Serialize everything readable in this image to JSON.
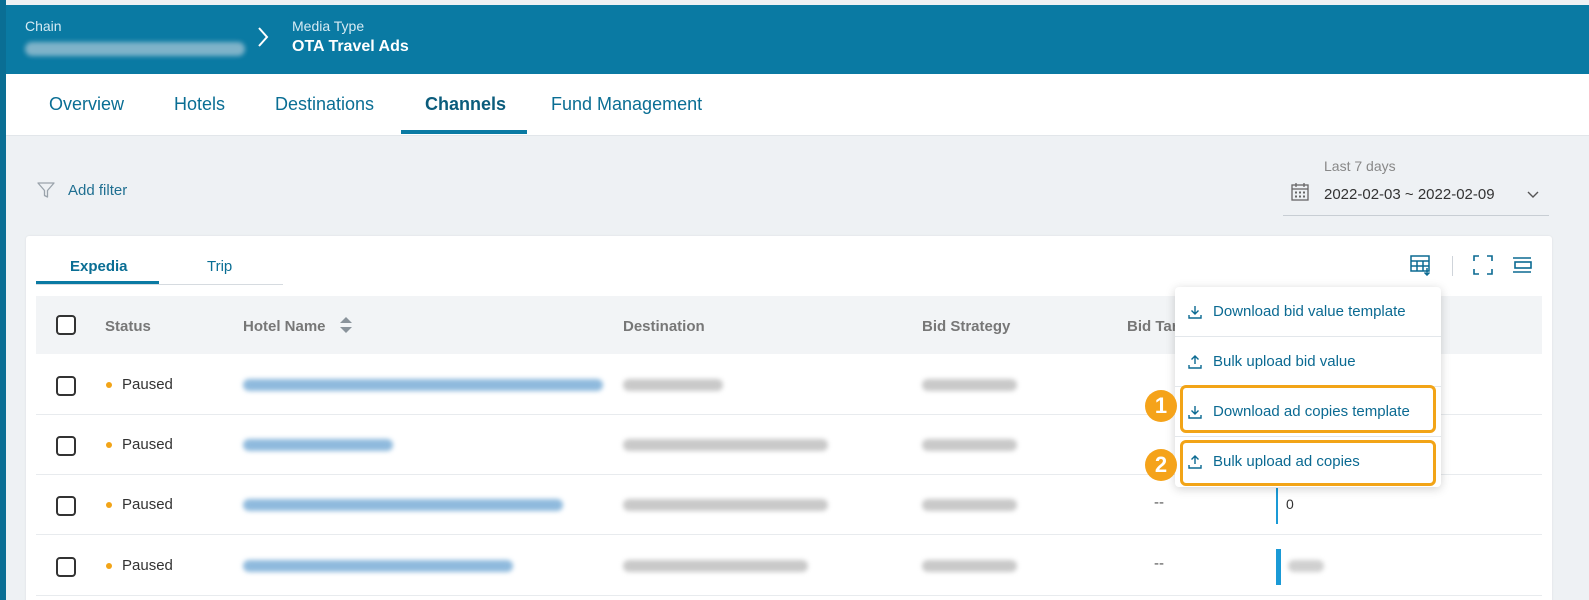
{
  "breadcrumb": {
    "chain_label": "Chain",
    "media_type_label": "Media Type",
    "media_type_value": "OTA Travel Ads"
  },
  "tabs": [
    {
      "label": "Overview"
    },
    {
      "label": "Hotels"
    },
    {
      "label": "Destinations"
    },
    {
      "label": "Channels",
      "active": true
    },
    {
      "label": "Fund Management"
    }
  ],
  "filter": {
    "label": "Add filter"
  },
  "date_range": {
    "preset": "Last 7 days",
    "value": "2022-02-03 ~ 2022-02-09"
  },
  "channel_tabs": [
    {
      "label": "Expedia",
      "active": true
    },
    {
      "label": "Trip"
    }
  ],
  "table": {
    "columns": [
      "Status",
      "Hotel Name",
      "Destination",
      "Bid Strategy",
      "Bid Tar"
    ],
    "rows": [
      {
        "status": "Paused",
        "bid_target": "",
        "bid_value": ""
      },
      {
        "status": "Paused",
        "bid_target": "",
        "bid_value": ""
      },
      {
        "status": "Paused",
        "bid_target": "--",
        "bid_value": "0"
      },
      {
        "status": "Paused",
        "bid_target": "--",
        "bid_value": ""
      }
    ]
  },
  "dropdown_menu": {
    "items": [
      {
        "label": "Download bid value template",
        "icon": "download-icon"
      },
      {
        "label": "Bulk upload bid value",
        "icon": "upload-icon"
      },
      {
        "label": "Download ad copies template",
        "icon": "download-icon",
        "step": "1"
      },
      {
        "label": "Bulk upload ad copies",
        "icon": "upload-icon",
        "step": "2"
      }
    ]
  },
  "colors": {
    "header_bg": "#0a7aa3",
    "accent": "#0a7aa3",
    "status_paused": "#f2a417",
    "highlight": "#f2a417"
  }
}
